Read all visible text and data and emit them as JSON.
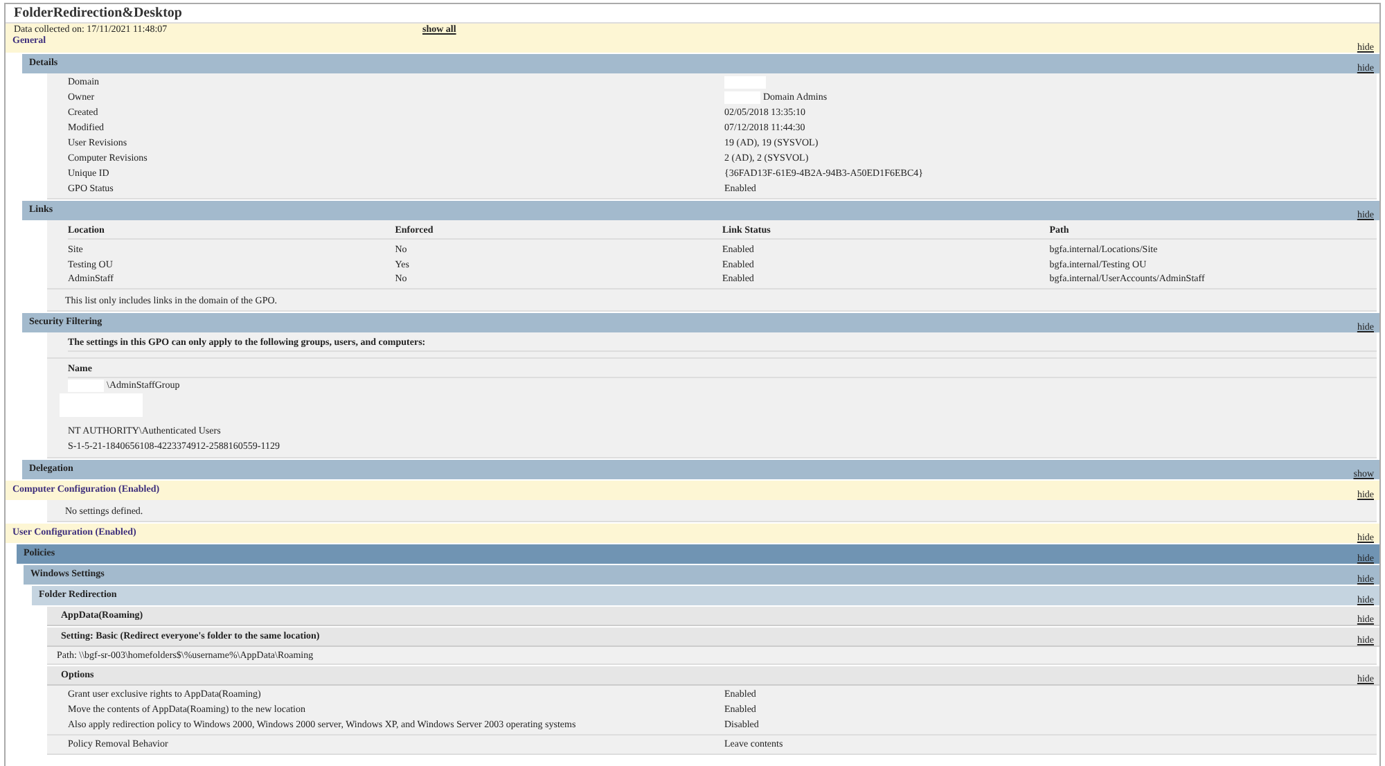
{
  "title": "FolderRedirection&Desktop",
  "collected": "Data collected on: 17/11/2021 11:48:07",
  "show_all": "show all",
  "sections": [
    {
      "title": "General",
      "kind": "category",
      "toggle": "hide",
      "children": [
        {
          "title": "Details",
          "kind": "section",
          "toggle": "hide",
          "content": [
            {
              "kind": "fields",
              "rows": [
                {
                  "label": "Domain",
                  "redacted": true
                },
                {
                  "label": "Owner",
                  "value": "Domain Admins",
                  "redacted": true
                },
                {
                  "label": "Created",
                  "value": "02/05/2018 13:35:10"
                },
                {
                  "label": "Modified",
                  "value": "07/12/2018 11:44:30"
                },
                {
                  "label": "User Revisions",
                  "value": "19 (AD), 19 (SYSVOL)"
                },
                {
                  "label": "Computer Revisions",
                  "value": "2 (AD), 2 (SYSVOL)"
                },
                {
                  "label": "Unique ID",
                  "value": "{36FAD13F-61E9-4B2A-94B3-A50ED1F6EBC4}"
                },
                {
                  "label": "GPO Status",
                  "value": "Enabled"
                }
              ]
            }
          ]
        },
        {
          "title": "Links",
          "kind": "section",
          "toggle": "hide",
          "content": [
            {
              "kind": "table",
              "columns": [
                "Location",
                "Enforced",
                "Link Status",
                "Path"
              ],
              "rows": [
                [
                  "Site",
                  "No",
                  "Enabled",
                  "bgfa.internal/Locations/Site"
                ],
                [
                  "Testing OU",
                  "Yes",
                  "Enabled",
                  "bgfa.internal/Testing OU"
                ],
                [
                  "AdminStaff",
                  "No",
                  "Enabled",
                  "bgfa.internal/UserAccounts/AdminStaff"
                ]
              ]
            },
            {
              "kind": "note",
              "text": "This list only includes links in the domain of the GPO."
            }
          ]
        },
        {
          "title": "Security Filtering",
          "kind": "section",
          "toggle": "hide",
          "content": [
            {
              "kind": "heading",
              "text": "The settings in this GPO can only apply to the following groups, users, and computers:"
            },
            {
              "kind": "list",
              "column": "Name",
              "rows": [
                {
                  "text": "\\AdminStaffGroup",
                  "redacted": true
                },
                {
                  "redacted": true
                },
                {
                  "text": "NT AUTHORITY\\Authenticated Users"
                },
                {
                  "text": "S-1-5-21-1840656108-4223374912-2588160559-1129"
                }
              ]
            }
          ]
        },
        {
          "title": "Delegation",
          "kind": "section",
          "toggle": "show"
        }
      ]
    },
    {
      "title": "Computer Configuration (Enabled)",
      "kind": "category",
      "toggle": "hide",
      "content": [
        {
          "kind": "note",
          "text": "No settings defined."
        }
      ]
    },
    {
      "title": "User Configuration (Enabled)",
      "kind": "category",
      "toggle": "hide",
      "children": [
        {
          "title": "Policies",
          "kind": "policy",
          "toggle": "hide",
          "children": [
            {
              "title": "Windows Settings",
              "kind": "group",
              "toggle": "hide",
              "children": [
                {
                  "title": "Folder Redirection",
                  "kind": "subgroup",
                  "toggle": "hide",
                  "children": [
                    {
                      "title": "AppData(Roaming)",
                      "kind": "item",
                      "toggle": "hide",
                      "children": [
                        {
                          "title": "Setting: Basic (Redirect everyone's folder to the same location)",
                          "kind": "item",
                          "toggle": "hide",
                          "content": [
                            {
                              "kind": "path",
                              "text": "Path: \\\\bgf-sr-003\\homefolders$\\%username%\\AppData\\Roaming"
                            }
                          ],
                          "children": [
                            {
                              "title": "Options",
                              "kind": "item",
                              "toggle": "hide",
                              "content": [
                                {
                                  "kind": "fields",
                                  "rows": [
                                    {
                                      "label": "Grant user exclusive rights to AppData(Roaming)",
                                      "value": "Enabled"
                                    },
                                    {
                                      "label": "Move the contents of AppData(Roaming) to the new location",
                                      "value": "Enabled"
                                    },
                                    {
                                      "label": "Also apply redirection policy to Windows 2000, Windows 2000 server, Windows XP, and Windows Server 2003 operating systems",
                                      "value": "Disabled"
                                    }
                                  ]
                                },
                                {
                                  "kind": "fields",
                                  "rows": [
                                    {
                                      "label": "Policy Removal Behavior",
                                      "value": "Leave contents"
                                    }
                                  ]
                                }
                              ]
                            }
                          ]
                        }
                      ]
                    }
                  ]
                }
              ]
            }
          ]
        }
      ]
    }
  ]
}
